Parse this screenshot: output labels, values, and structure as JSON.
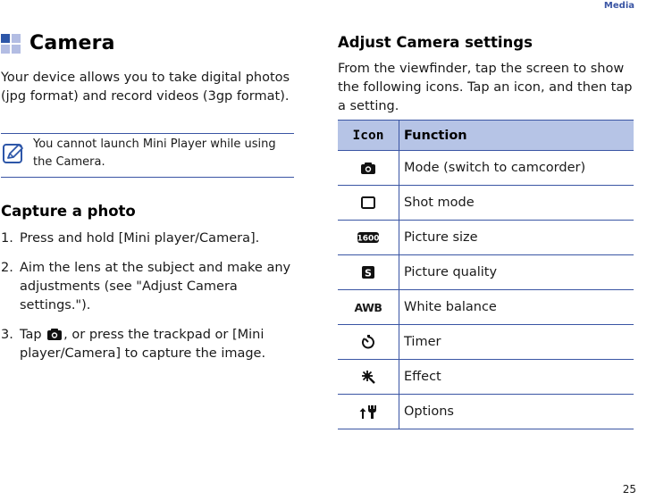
{
  "header": {
    "section": "Media",
    "page_number": "25"
  },
  "camera": {
    "title": "Camera",
    "intro": "Your device allows you to take digital photos (jpg format) and record videos (3gp format).",
    "note": "You cannot launch Mini Player while using the Camera."
  },
  "capture": {
    "title": "Capture a photo",
    "steps": [
      {
        "num": "1.",
        "text": "Press and hold [Mini player/Camera]."
      },
      {
        "num": "2.",
        "text": "Aim the lens at the subject and make any adjustments (see \"Adjust Camera settings.\")."
      },
      {
        "num": "3.",
        "text_before": "Tap",
        "text_after": ", or press the trackpad or [Mini player/Camera] to capture the image."
      }
    ]
  },
  "adjust": {
    "title": "Adjust Camera settings",
    "intro": "From the viewfinder, tap the screen to show the following icons. Tap an icon, and then tap a setting.",
    "table": {
      "headers": [
        "Icon",
        "Function"
      ],
      "rows": [
        {
          "icon": "camera-mode-icon",
          "function": "Mode (switch to camcorder)"
        },
        {
          "icon": "shot-mode-icon",
          "function": "Shot mode"
        },
        {
          "icon": "picture-size-icon",
          "icon_text": "1600",
          "function": "Picture size"
        },
        {
          "icon": "picture-quality-icon",
          "icon_text": "S",
          "function": "Picture quality"
        },
        {
          "icon": "white-balance-icon",
          "icon_text": "AWB",
          "function": "White balance"
        },
        {
          "icon": "timer-icon",
          "function": "Timer"
        },
        {
          "icon": "effect-icon",
          "function": "Effect"
        },
        {
          "icon": "options-icon",
          "function": "Options"
        }
      ]
    }
  },
  "colors": {
    "accent": "#3a55a4",
    "table_header_bg": "#b6c4e6",
    "title_icon_dark": "#2d56a8",
    "title_icon_light": "#b3bde3"
  }
}
